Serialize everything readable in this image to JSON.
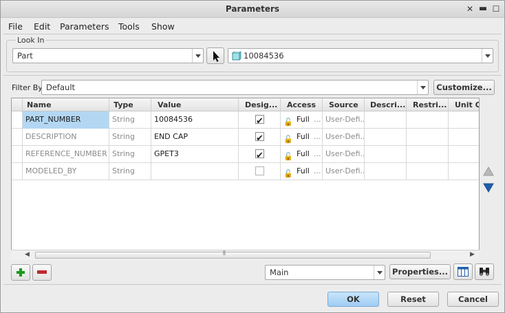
{
  "window": {
    "title": "Parameters"
  },
  "menu": [
    "File",
    "Edit",
    "Parameters",
    "Tools",
    "Show"
  ],
  "look_in": {
    "label": "Look In",
    "type_value": "Part",
    "item_value": "10084536"
  },
  "filter": {
    "label": "Filter By",
    "value": "Default",
    "customize_label": "Customize..."
  },
  "table": {
    "columns": [
      "Name",
      "Type",
      "Value",
      "Desig...",
      "Access",
      "Source",
      "Descri...",
      "Restri...",
      "Unit Q..."
    ],
    "rows": [
      {
        "name": "PART_NUMBER",
        "type": "String",
        "value": "10084536",
        "designate": true,
        "access": "Full",
        "source": "User-Defi..."
      },
      {
        "name": "DESCRIPTION",
        "type": "String",
        "value": "END CAP",
        "designate": true,
        "access": "Full",
        "source": "User-Defi..."
      },
      {
        "name": "REFERENCE_NUMBER",
        "type": "String",
        "value": "GPET3",
        "designate": true,
        "access": "Full",
        "source": "User-Defi..."
      },
      {
        "name": "MODELED_BY",
        "type": "String",
        "value": "",
        "designate": false,
        "access": "Full",
        "source": "User-Defi..."
      }
    ],
    "access_ellipsis": "..."
  },
  "bottom": {
    "view_value": "Main",
    "properties_label": "Properties...",
    "ok_label": "OK",
    "reset_label": "Reset",
    "cancel_label": "Cancel"
  },
  "colors": {
    "accent": "#b3d7f3",
    "add": "#1a9a1a",
    "remove": "#c0282d",
    "move": "#1f5fa8"
  },
  "icons": {
    "add": "plus-icon",
    "remove": "minus-icon",
    "move_up": "arrow-up-icon",
    "move_down": "arrow-down-icon",
    "pointer": "cursor-icon",
    "part": "part-cube-icon",
    "columns": "table-columns-icon",
    "find": "binoculars-icon",
    "lock": "lock-icon"
  }
}
